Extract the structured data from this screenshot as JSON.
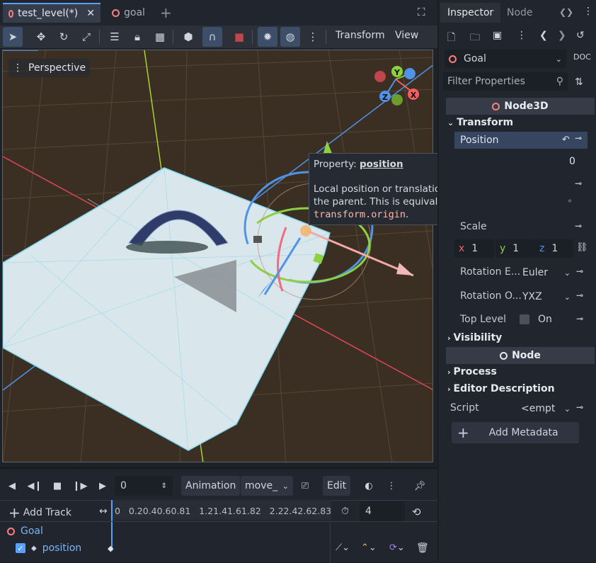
{
  "tabs": [
    {
      "label": "test_level(*)",
      "active": true
    },
    {
      "label": "goal",
      "active": false
    }
  ],
  "toolbar": {
    "transform_label": "Transform",
    "view_label": "View"
  },
  "viewport": {
    "perspective_label": "Perspective",
    "gizmo_axes": [
      "Y",
      "Z",
      "X"
    ]
  },
  "tooltip": {
    "prefix": "Property: ",
    "property": "position",
    "line1": "Local position or translation of this node relative to",
    "line2": "the parent. This is equivalent to",
    "code": "transform.origin",
    "suffix": "."
  },
  "inspector": {
    "tab_inspector": "Inspector",
    "tab_node": "Node",
    "node_name": "Goal",
    "filter_placeholder": "Filter Properties",
    "section_node3d": "Node3D",
    "group_transform": "Transform",
    "position_label": "Position",
    "position_partial_value": "0",
    "scale_label": "Scale",
    "scale_partial": "°",
    "scale_x_axis": "x",
    "scale_x": "1",
    "scale_y_axis": "y",
    "scale_y": "1",
    "scale_z_axis": "z",
    "scale_z": "1",
    "rotation_edit_label": "Rotation E...",
    "rotation_edit_value": "Euler",
    "rotation_order_label": "Rotation O...",
    "rotation_order_value": "YXZ",
    "top_level_label": "Top Level",
    "top_level_value": "On",
    "group_visibility": "Visibility",
    "section_node": "Node",
    "group_process": "Process",
    "group_editor_description": "Editor Description",
    "script_label": "Script",
    "script_value": "<empt",
    "add_metadata_label": "Add Metadata"
  },
  "animation": {
    "time_value": "0",
    "animation_label": "Animation",
    "animation_name": "move_",
    "edit_label": "Edit",
    "add_track_label": "Add Track",
    "ticks": "0   0.20.40.60.81   1.21.41.61.82   2.22.42.62.83",
    "length_value": "4",
    "track_node": "Goal",
    "track_property": "position"
  },
  "colors": {
    "accent": "#5aa0ff",
    "x_axis": "#f55f5f",
    "y_axis": "#8cd13f",
    "z_axis": "#4e93e8",
    "viewport_bg": "#3b2f23"
  }
}
